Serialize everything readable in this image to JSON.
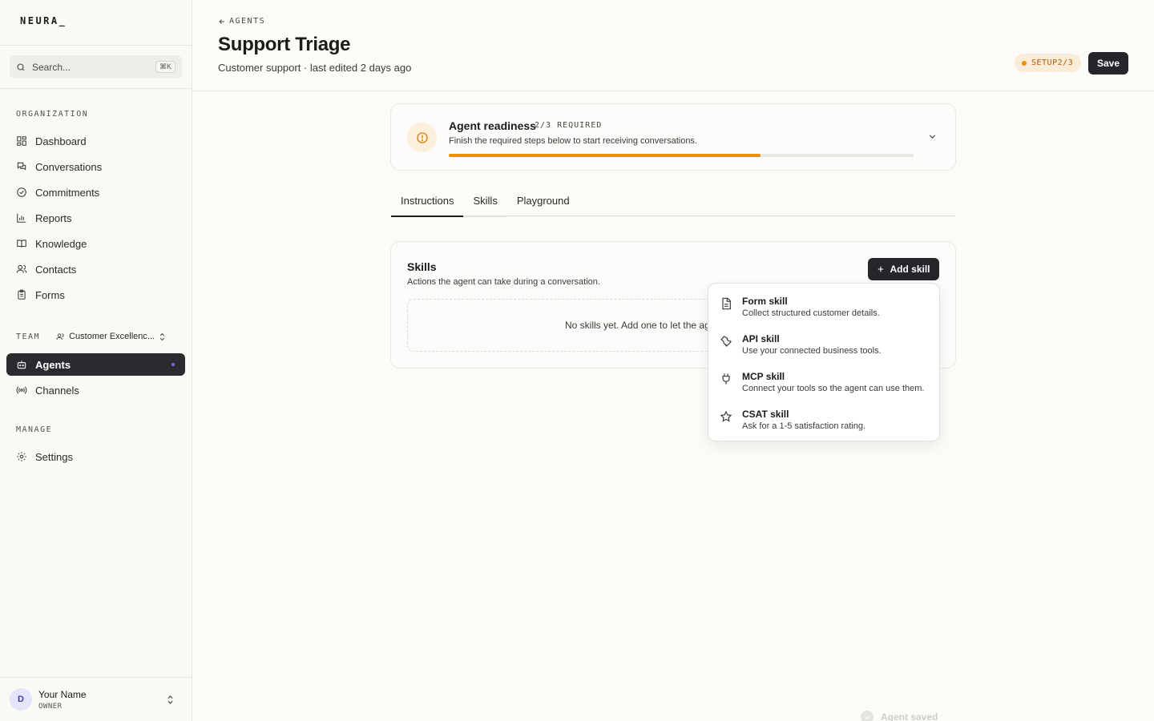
{
  "sidebar": {
    "logo": "NEURA_",
    "search": {
      "placeholder": "Search...",
      "shortcut": "⌘K"
    },
    "organization_label": "ORGANIZATION",
    "org_items": [
      {
        "label": "Dashboard",
        "icon": "dashboard-icon"
      },
      {
        "label": "Conversations",
        "icon": "conversations-icon"
      },
      {
        "label": "Commitments",
        "icon": "check-circle-icon"
      },
      {
        "label": "Reports",
        "icon": "bar-chart-icon"
      },
      {
        "label": "Knowledge",
        "icon": "book-icon"
      },
      {
        "label": "Contacts",
        "icon": "contacts-icon"
      },
      {
        "label": "Forms",
        "icon": "clipboard-icon"
      }
    ],
    "team_label": "TEAM",
    "team_name": "Customer Excellenc...",
    "team_items": [
      {
        "label": "Agents",
        "icon": "bot-icon",
        "active": true
      },
      {
        "label": "Channels",
        "icon": "broadcast-icon"
      }
    ],
    "manage_label": "MANAGE",
    "manage_items": [
      {
        "label": "Settings",
        "icon": "gear-icon"
      }
    ],
    "user": {
      "initial": "D",
      "name": "Your Name",
      "role": "OWNER"
    }
  },
  "header": {
    "breadcrumb": "AGENTS",
    "title": "Support Triage",
    "subtitle": "Customer support · last edited 2 days ago",
    "setup_badge": "SETUP2/3",
    "save_label": "Save"
  },
  "readiness": {
    "title": "Agent readiness",
    "required": "2/3 REQUIRED",
    "description": "Finish the required steps below to start receiving conversations.",
    "progress_fraction": 0.67,
    "accent_color": "#f08c00"
  },
  "tabs": [
    {
      "label": "Instructions",
      "active": true
    },
    {
      "label": "Skills"
    },
    {
      "label": "Playground"
    }
  ],
  "skills": {
    "title": "Skills",
    "description": "Actions the agent can take during a conversation.",
    "add_label": "Add skill",
    "empty_text": "No skills yet. Add one to let the ag"
  },
  "skill_menu": [
    {
      "title": "Form skill",
      "description": "Collect structured customer details.",
      "icon": "document-icon"
    },
    {
      "title": "API skill",
      "description": "Use your connected business tools.",
      "icon": "wrench-icon"
    },
    {
      "title": "MCP skill",
      "description": "Connect your tools so the agent can use them.",
      "icon": "plug-icon"
    },
    {
      "title": "CSAT skill",
      "description": "Ask for a 1-5 satisfaction rating.",
      "icon": "star-icon"
    }
  ],
  "toast": {
    "label": "Agent saved"
  }
}
